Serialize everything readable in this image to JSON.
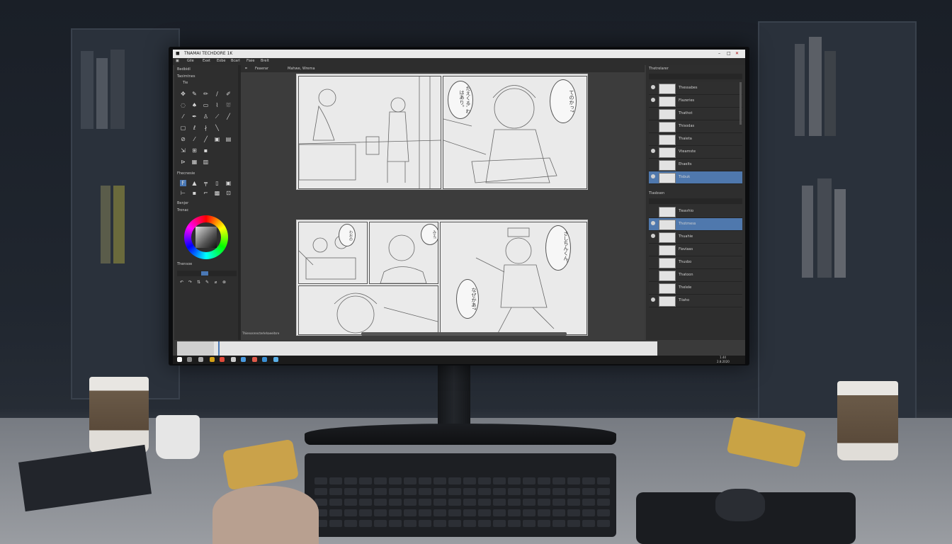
{
  "window": {
    "title": "TNAMAI TECHDORE 1K"
  },
  "menu": [
    "Gile",
    "Exet",
    "Eobe",
    "Bcarl",
    "Fiaie",
    "Brelt"
  ],
  "doc_tabs": [
    "Feaerar",
    "Mahwe, Wrema"
  ],
  "tools_panel": {
    "title": "Bedbidl",
    "subtitle": "Taoimtnes",
    "sub2": "Tie"
  },
  "sub_tools": {
    "title": "Fhecnesie"
  },
  "brush": {
    "title": "Benjer",
    "subtitle": "Tronac"
  },
  "color": {
    "title": "Thensoe"
  },
  "bubbles": {
    "b1": "たえくる, わはあり。",
    "b2": "てのかっ?",
    "b3": "わおの",
    "b4": "みえ!",
    "b5": "さしちんくん。",
    "b6": "なぜかあ?"
  },
  "layers_top": {
    "title": "Thetrelarer",
    "rows": [
      {
        "name": "Thessabes",
        "selected": false
      },
      {
        "name": "Flazeries",
        "selected": false
      },
      {
        "name": "Thathot",
        "selected": false
      },
      {
        "name": "Thisodas",
        "selected": false
      },
      {
        "name": "Thaieta",
        "selected": false
      },
      {
        "name": "Vteamste",
        "selected": false
      },
      {
        "name": "Ehaelts",
        "selected": false
      },
      {
        "name": "Tisbuk",
        "selected": true
      }
    ]
  },
  "layers_bottom": {
    "title": "Tlasbsen",
    "rows": [
      {
        "name": "Tieavhio",
        "selected": false
      },
      {
        "name": "Thotmess",
        "selected": true
      },
      {
        "name": "Thuahie",
        "selected": false
      },
      {
        "name": "Fiaviaas",
        "selected": false
      },
      {
        "name": "Thusbo",
        "selected": false
      },
      {
        "name": "Thatoon",
        "selected": false
      },
      {
        "name": "Thelele",
        "selected": false
      },
      {
        "name": "Tliaho",
        "selected": false
      }
    ]
  },
  "status": {
    "canvas_info": "Thienosrencterlehaeeitsre"
  },
  "taskbar": {
    "clock_time": "1.44",
    "clock_date": "2.8.2020"
  }
}
